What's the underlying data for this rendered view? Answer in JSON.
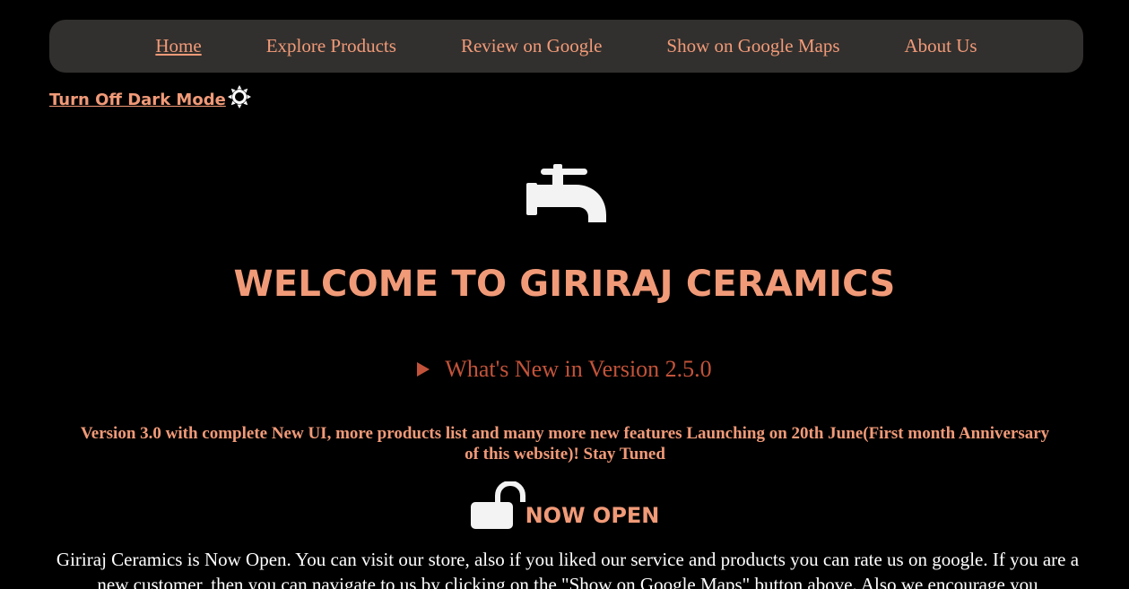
{
  "nav": {
    "items": [
      {
        "label": "Home",
        "active": true
      },
      {
        "label": "Explore Products",
        "active": false
      },
      {
        "label": "Review on Google",
        "active": false
      },
      {
        "label": "Show on Google Maps",
        "active": false
      },
      {
        "label": "About Us",
        "active": false
      }
    ]
  },
  "dark_mode_toggle": {
    "label": "Turn Off Dark Mode",
    "icon": "sun-icon"
  },
  "hero": {
    "icon": "faucet-icon",
    "title": "WELCOME TO GIRIRAJ CERAMICS"
  },
  "whats_new": {
    "label": "What's New in Version 2.5.0",
    "expanded": false
  },
  "announcement": "Version 3.0 with complete New UI, more products list and many more new features Launching on 20th June(First month Anniversary of this website)! Stay Tuned",
  "status": {
    "icon": "unlock-icon",
    "label": "NOW OPEN"
  },
  "intro_text": "Giriraj Ceramics is Now Open. You can visit our store, also if you liked our service and products you can rate us on google. If you are a new customer, then you can navigate to us by clicking on the \"Show on Google Maps\" button above. Also we encourage you",
  "colors": {
    "background": "#000000",
    "navbar": "#32302e",
    "accent": "#f19a78",
    "summary": "#c2533a",
    "text": "#ffffff"
  }
}
